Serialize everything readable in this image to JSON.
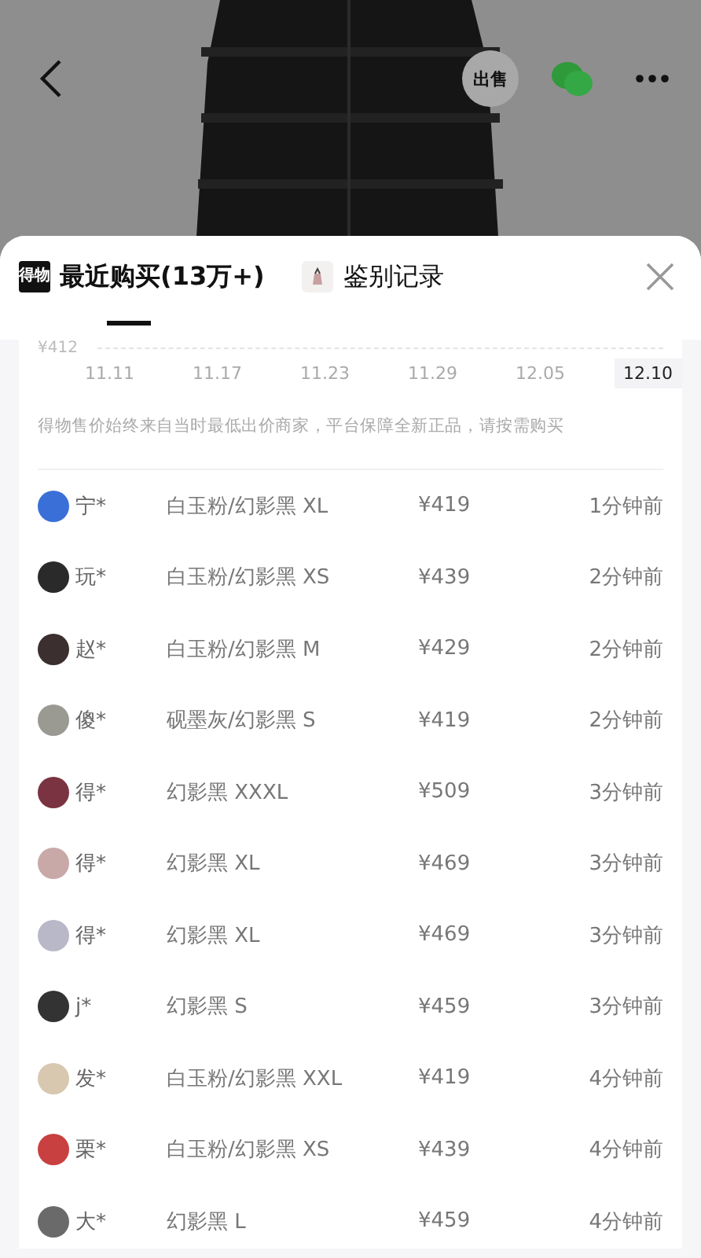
{
  "header": {
    "sell_badge": "出售"
  },
  "tabs": [
    {
      "label": "最近购买(13万+)",
      "logo": "得物",
      "selected": true
    },
    {
      "label": "鉴别记录",
      "selected": false
    }
  ],
  "price_chart": {
    "price_label": "¥412",
    "dates": [
      {
        "label": "11.11",
        "selected": false
      },
      {
        "label": "11.17",
        "selected": false
      },
      {
        "label": "11.23",
        "selected": false
      },
      {
        "label": "11.29",
        "selected": false
      },
      {
        "label": "12.05",
        "selected": false
      },
      {
        "label": "12.10",
        "selected": true
      }
    ]
  },
  "notice": "得物售价始终来自当时最低出价商家，平台保障全新正品，请按需购买",
  "purchases": [
    {
      "buyer": "宁*",
      "variant": "白玉粉/幻影黑 XL",
      "price": "¥419",
      "time": "1分钟前",
      "color": "#3a6fd8"
    },
    {
      "buyer": "玩*",
      "variant": "白玉粉/幻影黑 XS",
      "price": "¥439",
      "time": "2分钟前",
      "color": "#2a2a2a"
    },
    {
      "buyer": "赵*",
      "variant": "白玉粉/幻影黑 M",
      "price": "¥429",
      "time": "2分钟前",
      "color": "#3b2f2f"
    },
    {
      "buyer": "傻*",
      "variant": "砚墨灰/幻影黑 S",
      "price": "¥419",
      "time": "2分钟前",
      "color": "#9a9a92"
    },
    {
      "buyer": "得*",
      "variant": "幻影黑 XXXL",
      "price": "¥509",
      "time": "3分钟前",
      "color": "#7a3340"
    },
    {
      "buyer": "得*",
      "variant": "幻影黑 XL",
      "price": "¥469",
      "time": "3分钟前",
      "color": "#c9a8a8"
    },
    {
      "buyer": "得*",
      "variant": "幻影黑 XL",
      "price": "¥469",
      "time": "3分钟前",
      "color": "#b8b8c8"
    },
    {
      "buyer": "j*",
      "variant": "幻影黑 S",
      "price": "¥459",
      "time": "3分钟前",
      "color": "#333333"
    },
    {
      "buyer": "发*",
      "variant": "白玉粉/幻影黑 XXL",
      "price": "¥419",
      "time": "4分钟前",
      "color": "#d8c8b0"
    },
    {
      "buyer": "栗*",
      "variant": "白玉粉/幻影黑 XS",
      "price": "¥439",
      "time": "4分钟前",
      "color": "#c84040"
    },
    {
      "buyer": "大*",
      "variant": "幻影黑 L",
      "price": "¥459",
      "time": "4分钟前",
      "color": "#6a6a6a"
    }
  ]
}
